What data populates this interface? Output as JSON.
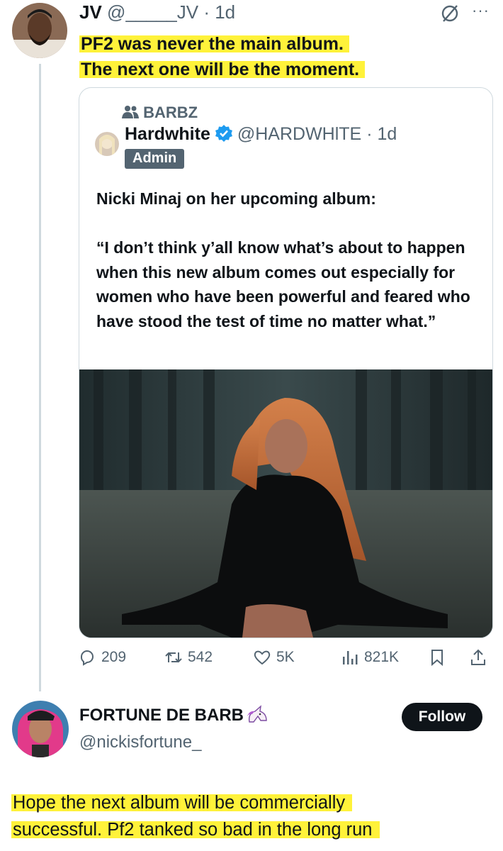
{
  "tweet1": {
    "name": "JV",
    "handle": "@_____JV",
    "time": "· 1d",
    "more": "···",
    "lines": [
      "PF2 was never the main album.",
      "The next one will be the moment."
    ]
  },
  "quote": {
    "community": "BARBZ",
    "name": "Hardwhite",
    "handle": "@HARDWHlTE",
    "time": "· 1d",
    "badge": "Admin",
    "text1": "Nicki Minaj on her upcoming album:",
    "text2": "“I don’t think y’all know what’s about to happen when this new album comes out especially for women who have been powerful and feared who have stood the test of time no matter what.”"
  },
  "actions": {
    "replies": "209",
    "reposts": "542",
    "likes": "5K",
    "views": "821K"
  },
  "tweet2": {
    "name": "FORTUNE DE BARB",
    "handle": "@nickisfortune_",
    "follow_label": "Follow",
    "lines": [
      "Hope the next album will be commercially",
      "successful. Pf2 tanked so bad in the long run"
    ]
  },
  "colors": {
    "highlight": "#fff23a",
    "verified": "#1d9bf0",
    "muted": "#536471"
  }
}
